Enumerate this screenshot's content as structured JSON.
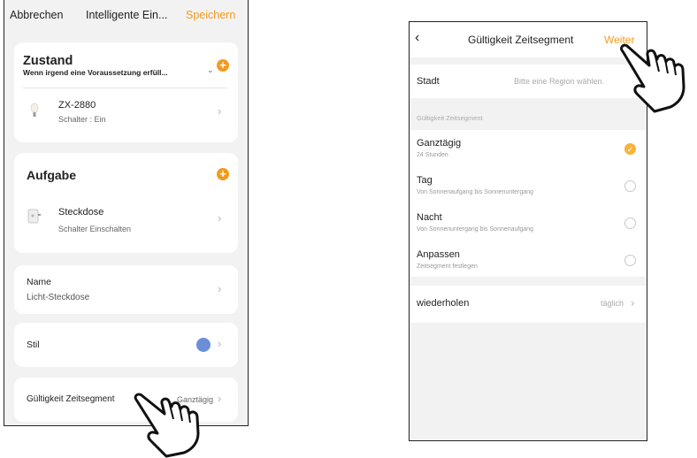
{
  "left_screen": {
    "topbar": {
      "cancel": "Abbrechen",
      "title": "Intelligente Ein...",
      "save": "Speichern"
    },
    "condition": {
      "title": "Zustand",
      "subtitle": "Wenn irgend eine Voraussetzung erfüll...",
      "subtitle_caret": "⌄",
      "device_name": "ZX-2880",
      "device_state": "Schalter : Ein"
    },
    "task": {
      "title": "Aufgabe",
      "device_name": "Steckdose",
      "device_action": "Schalter Einschalten"
    },
    "name_row": {
      "label": "Name",
      "value": "Licht-Steckdose"
    },
    "style_row": {
      "label": "Stil",
      "color": "#6b8fd6"
    },
    "validity_row": {
      "label": "Gültigkeit Zeitsegment",
      "value": "Ganztägig"
    }
  },
  "right_screen": {
    "topbar": {
      "back": "‹",
      "title": "Gültigkeit Zeitsegment",
      "next": "Weiter"
    },
    "city": {
      "label": "Stadt",
      "placeholder": "Bitte eine Region wählen."
    },
    "section_header": "Gültigkeit Zeitsegment",
    "options": [
      {
        "title": "Ganztägig",
        "subtitle": "24 Stunden",
        "selected": true
      },
      {
        "title": "Tag",
        "subtitle": "Von Sonnenaufgang bis Sonnenuntergang",
        "selected": false
      },
      {
        "title": "Nacht",
        "subtitle": "Von Sonnenuntergang bis Sonnenaufgang",
        "selected": false
      },
      {
        "title": "Anpassen",
        "subtitle": "Zeitsegment festlegen",
        "selected": false
      }
    ],
    "repeat": {
      "label": "wiederholen",
      "value": "täglich"
    }
  },
  "icons": {
    "chevron": "›",
    "plus": "+",
    "check": "✓",
    "pointing_hand": "pointing-hand-icon"
  },
  "colors": {
    "accent": "#f39a1f",
    "radio_selected": "#f6b43a",
    "style_dot": "#6b8fd6"
  }
}
